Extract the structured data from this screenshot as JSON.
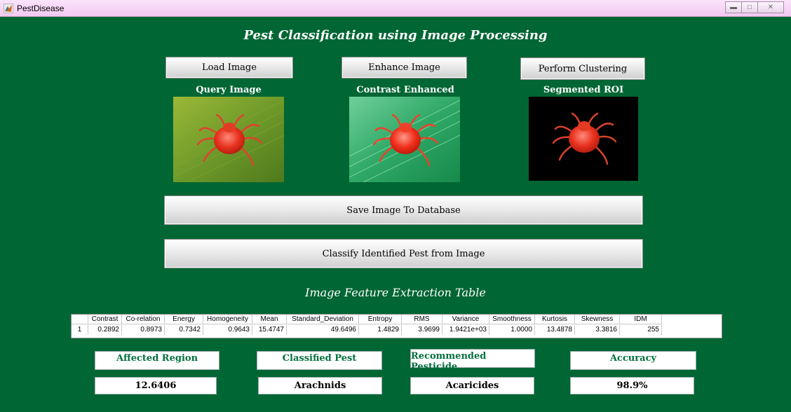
{
  "window": {
    "title": "PestDisease",
    "controls": [
      "minimize",
      "maximize",
      "close"
    ]
  },
  "main_title": "Pest Classification using Image Processing",
  "buttons": {
    "load": "Load Image",
    "enhance": "Enhance Image",
    "cluster": "Perform Clustering",
    "save": "Save Image To Database",
    "classify": "Classify Identified Pest from Image"
  },
  "images": {
    "query_label": "Query Image",
    "enhanced_label": "Contrast Enhanced",
    "segmented_label": "Segmented ROI"
  },
  "table": {
    "title": "Image Feature Extraction Table",
    "columns": [
      "",
      "Contrast",
      "Co-relation",
      "Energy",
      "Homogeneity",
      "Mean",
      "Standard_Deviation",
      "Entropy",
      "RMS",
      "Variance",
      "Smoothness",
      "Kurtosis",
      "Skewness",
      "IDM"
    ],
    "row": [
      "1",
      "0.2892",
      "0.8973",
      "0.7342",
      "0.9643",
      "15.4747",
      "49.6496",
      "1.4829",
      "3.9699",
      "1.9421e+03",
      "1.0000",
      "13.4878",
      "3.3816",
      "255"
    ]
  },
  "results": {
    "affected_label": "Affected Region",
    "affected_value": "12.6406",
    "pest_label": "Classified Pest",
    "pest_value": "Arachnids",
    "pesticide_label": "Recommended Pesticide",
    "pesticide_value": "Acaricides",
    "accuracy_label": "Accuracy",
    "accuracy_value": "98.9%"
  },
  "colors": {
    "background": "#006633",
    "label_text": "#00703c",
    "titlebar": "#f6d2f6"
  }
}
